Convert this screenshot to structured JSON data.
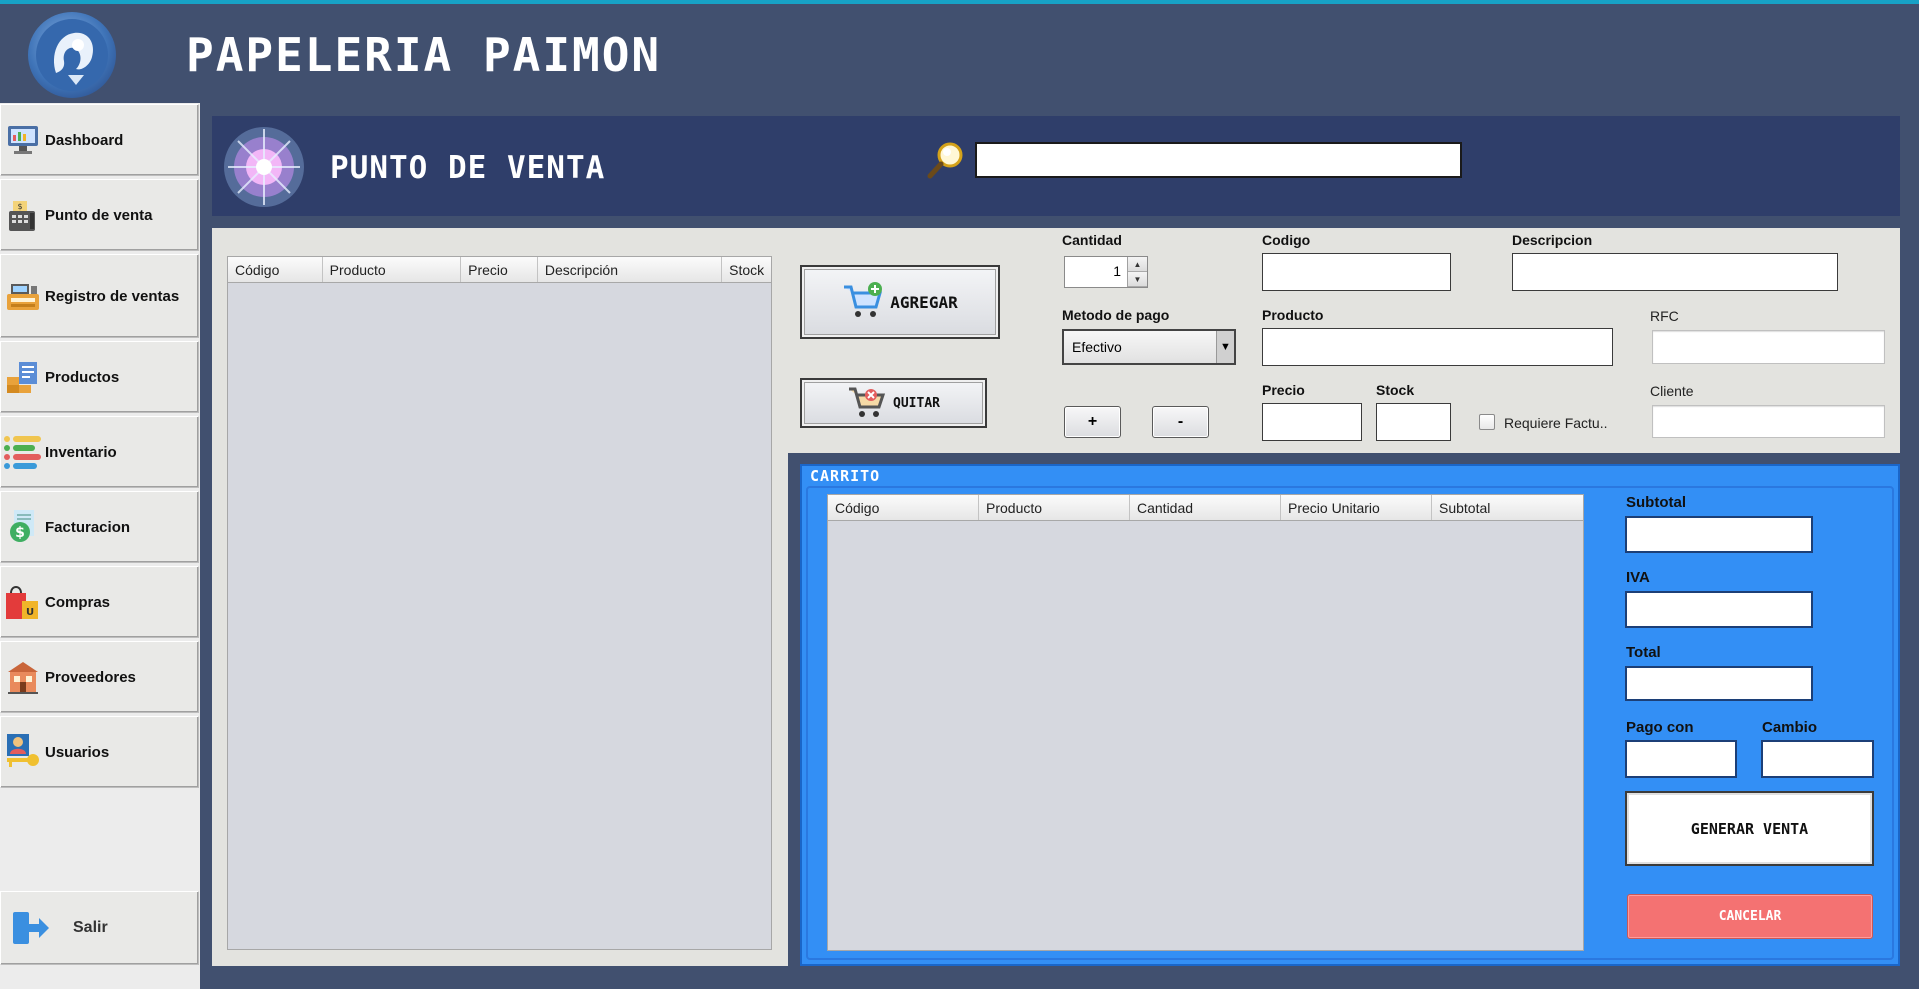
{
  "app": {
    "title": "PAPELERIA PAIMON",
    "accent_color": "#17a2c6",
    "background_color": "#41506f"
  },
  "sidebar": {
    "items": [
      {
        "label": "Dashboard",
        "icon": "dashboard-icon"
      },
      {
        "label": "Punto de venta",
        "icon": "cash-register-icon"
      },
      {
        "label": "Registro de ventas",
        "icon": "register-icon"
      },
      {
        "label": "Productos",
        "icon": "products-icon"
      },
      {
        "label": "Inventario",
        "icon": "inventory-icon"
      },
      {
        "label": "Facturacion",
        "icon": "invoice-icon"
      },
      {
        "label": "Compras",
        "icon": "shopping-bag-icon"
      },
      {
        "label": "Proveedores",
        "icon": "store-icon"
      },
      {
        "label": "Usuarios",
        "icon": "users-icon"
      }
    ],
    "exit_label": "Salir"
  },
  "page": {
    "title": "PUNTO DE VENTA",
    "search_value": ""
  },
  "products_table": {
    "columns": [
      "Código",
      "Producto",
      "Precio",
      "Descripción",
      "Stock"
    ],
    "rows": []
  },
  "actions": {
    "add_label": "AGREGAR",
    "remove_label": "QUITAR",
    "plus_label": "+",
    "minus_label": "-"
  },
  "form": {
    "cantidad_label": "Cantidad",
    "cantidad_value": "1",
    "codigo_label": "Codigo",
    "codigo_value": "",
    "descripcion_label": "Descripcion",
    "descripcion_value": "",
    "metodo_label": "Metodo de pago",
    "metodo_value": "Efectivo",
    "producto_label": "Producto",
    "producto_value": "",
    "rfc_label": "RFC",
    "rfc_value": "",
    "precio_label": "Precio",
    "precio_value": "",
    "stock_label": "Stock",
    "stock_value": "",
    "factura_label": "Requiere Factu..",
    "factura_checked": false,
    "cliente_label": "Cliente",
    "cliente_value": ""
  },
  "cart": {
    "title": "CARRITO",
    "color": "#338ff5",
    "columns": [
      "Código",
      "Producto",
      "Cantidad",
      "Precio Unitario",
      "Subtotal"
    ],
    "rows": [],
    "subtotal_label": "Subtotal",
    "iva_label": "IVA",
    "total_label": "Total",
    "pago_label": "Pago con",
    "cambio_label": "Cambio",
    "generate_label": "GENERAR VENTA",
    "cancel_label": "CANCELAR",
    "cancel_color": "#f47272"
  }
}
